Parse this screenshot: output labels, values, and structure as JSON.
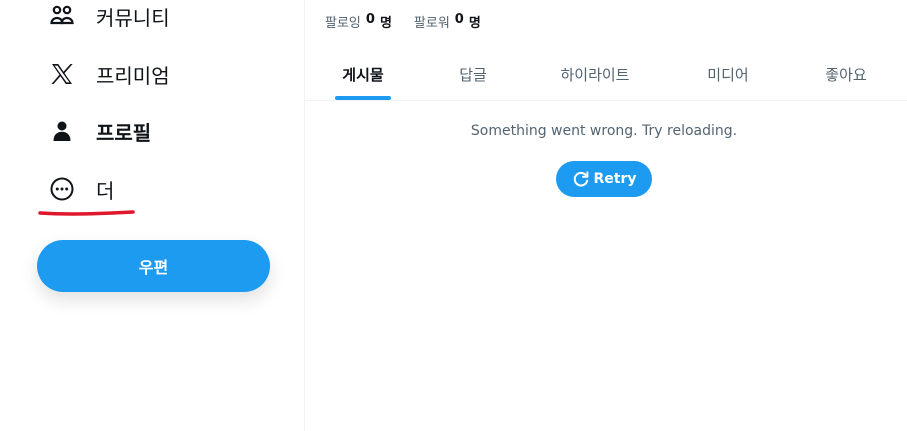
{
  "sidebar": {
    "items": [
      {
        "label": "커뮤니티",
        "icon": "communities-icon"
      },
      {
        "label": "프리미엄",
        "icon": "x-logo-icon"
      },
      {
        "label": "프로필",
        "icon": "profile-icon"
      },
      {
        "label": "더",
        "icon": "more-circle-icon"
      }
    ],
    "post_button_label": "우편"
  },
  "profile": {
    "following_label": "팔로잉",
    "following_count": "0",
    "following_unit": "명",
    "followers_label": "팔로워",
    "followers_count": "0",
    "followers_unit": "명"
  },
  "tabs": [
    {
      "label": "게시물",
      "active": true
    },
    {
      "label": "답글",
      "active": false
    },
    {
      "label": "하이라이트",
      "active": false
    },
    {
      "label": "미디어",
      "active": false
    },
    {
      "label": "좋아요",
      "active": false
    }
  ],
  "content": {
    "error_message": "Something went wrong. Try reloading.",
    "retry_label": "Retry"
  },
  "colors": {
    "accent": "#1d9bf0",
    "annotation": "#e0162b",
    "text_primary": "#0f1419",
    "text_secondary": "#536471"
  }
}
